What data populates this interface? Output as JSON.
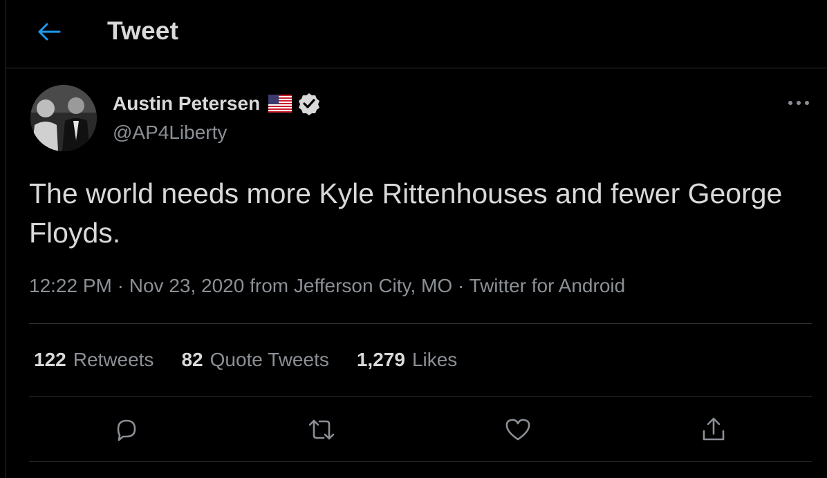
{
  "header": {
    "title": "Tweet",
    "back_icon": "arrow-left-icon"
  },
  "author": {
    "name": "Austin Petersen",
    "handle": "@AP4Liberty",
    "flag_icon": "us-flag-icon",
    "verified_icon": "verified-badge-icon"
  },
  "tweet": {
    "text": "The world needs more Kyle Rittenhouses and fewer George Floyds.",
    "time": "12:22 PM",
    "date": "Nov 23, 2020",
    "location_prefix": "from",
    "location": "Jefferson City, MO",
    "source": "Twitter for Android",
    "separator": "·"
  },
  "stats": {
    "retweets_count": "122",
    "retweets_label": "Retweets",
    "quotes_count": "82",
    "quotes_label": "Quote Tweets",
    "likes_count": "1,279",
    "likes_label": "Likes"
  },
  "actions": [
    "reply-icon",
    "retweet-icon",
    "like-icon",
    "share-icon"
  ],
  "colors": {
    "background": "#000000",
    "accent": "#1d9bf0",
    "text_primary": "#d9d9d9",
    "text_secondary": "#8b9096",
    "divider": "#2f3336"
  }
}
